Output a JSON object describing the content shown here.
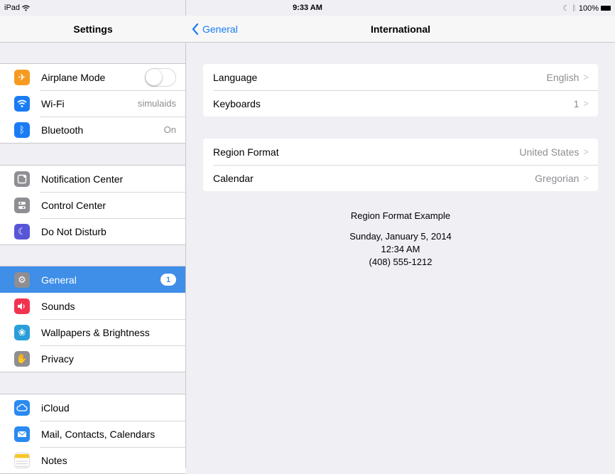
{
  "status": {
    "device": "iPad",
    "time": "9:33 AM",
    "battery": "100%"
  },
  "sidebar": {
    "title": "Settings",
    "groups": [
      [
        {
          "label": "Airplane Mode",
          "icon": "airplane-icon",
          "color": "#f79a22"
        },
        {
          "label": "Wi-Fi",
          "value": "simulaids",
          "icon": "wifi-icon",
          "color": "#1a7cf5"
        },
        {
          "label": "Bluetooth",
          "value": "On",
          "icon": "bluetooth-icon",
          "color": "#1a7cf5"
        }
      ],
      [
        {
          "label": "Notification Center",
          "icon": "notification-center-icon",
          "color": "#8e8e93"
        },
        {
          "label": "Control Center",
          "icon": "control-center-icon",
          "color": "#8e8e93"
        },
        {
          "label": "Do Not Disturb",
          "icon": "moon-icon",
          "color": "#5856d6"
        }
      ],
      [
        {
          "label": "General",
          "badge": "1",
          "icon": "gear-icon",
          "color": "#8e8e93",
          "selected": true
        },
        {
          "label": "Sounds",
          "icon": "speaker-icon",
          "color": "#f2334f"
        },
        {
          "label": "Wallpapers & Brightness",
          "icon": "flower-icon",
          "color": "#2a9ed9"
        },
        {
          "label": "Privacy",
          "icon": "hand-icon",
          "color": "#8e8e93"
        }
      ],
      [
        {
          "label": "iCloud",
          "icon": "cloud-icon",
          "color": "#2a8af0"
        },
        {
          "label": "Mail, Contacts, Calendars",
          "icon": "mail-icon",
          "color": "#2a8af0"
        },
        {
          "label": "Notes",
          "icon": "notes-icon",
          "color": "#f7c628"
        }
      ]
    ]
  },
  "detail": {
    "back_label": "General",
    "title": "International",
    "groups": [
      [
        {
          "label": "Language",
          "value": "English"
        },
        {
          "label": "Keyboards",
          "value": "1"
        }
      ],
      [
        {
          "label": "Region Format",
          "value": "United States"
        },
        {
          "label": "Calendar",
          "value": "Gregorian"
        }
      ]
    ],
    "example": {
      "heading": "Region Format Example",
      "date": "Sunday, January 5, 2014",
      "time": "12:34 AM",
      "phone": "(408) 555-1212"
    }
  }
}
